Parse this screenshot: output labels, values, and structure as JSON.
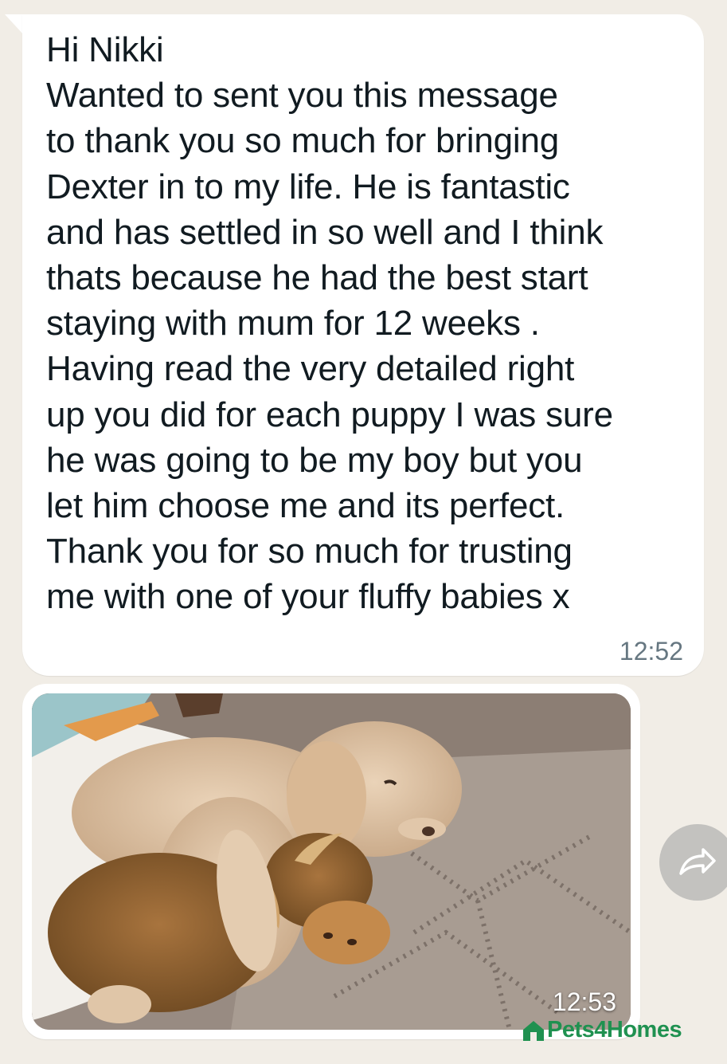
{
  "message": {
    "lines": [
      "Hi Nikki",
      "Wanted to sent you this message",
      "to thank you so much for bringing",
      "Dexter in to my life. He is fantastic",
      "and has settled in so well and I think",
      "thats because he had the best start",
      "staying with mum for 12 weeks .",
      "Having read the very detailed right",
      "up you did for each puppy I was sure",
      "he was going to be my boy but you",
      "let him choose me and its perfect.",
      "Thank you for so much for trusting",
      "me with one of your fluffy babies x"
    ],
    "time": "12:52"
  },
  "image_message": {
    "time": "12:53"
  },
  "forward_icon": "forward-arrow-icon",
  "watermark": {
    "text": "Pets4Homes",
    "color": "#1f9150"
  },
  "colors": {
    "chat_background": "#f1ede6",
    "bubble": "#ffffff",
    "text": "#111b21",
    "timestamp": "#667781"
  }
}
